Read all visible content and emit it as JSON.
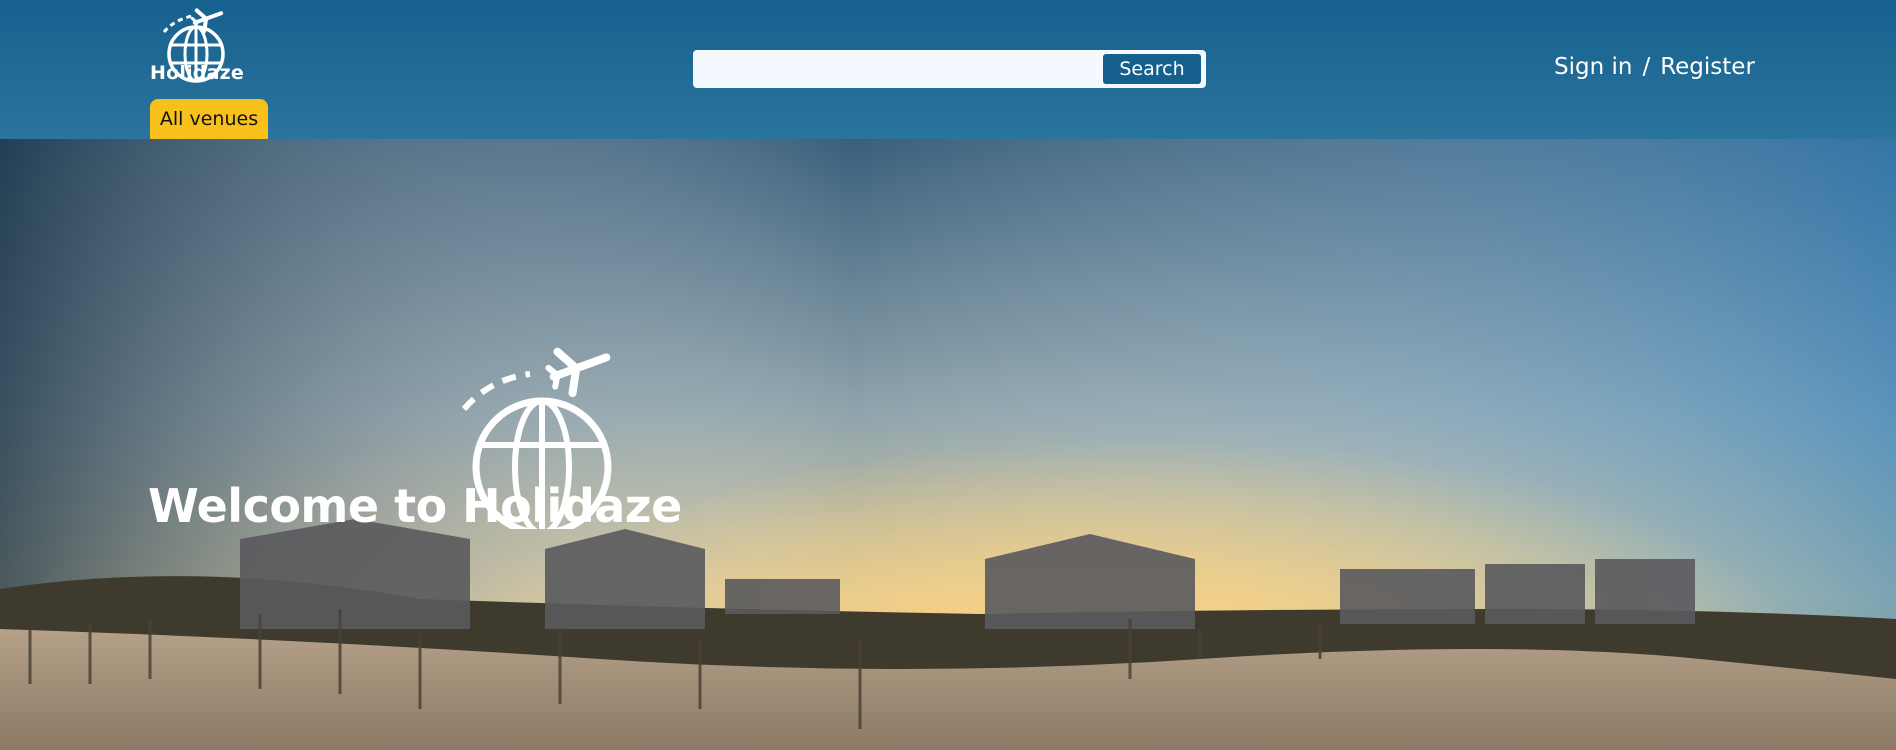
{
  "header": {
    "logo_text": "Holidaze",
    "nav_all_venues": "All venues",
    "search": {
      "placeholder": "",
      "value": "",
      "button_label": "Search"
    },
    "auth": {
      "sign_in": "Sign in",
      "separator": "/",
      "register": "Register"
    }
  },
  "hero": {
    "title": "Welcome to Holidaze"
  },
  "colors": {
    "header_top": "#16618e",
    "header_bottom": "#2a749d",
    "accent_yellow": "#f7c01a",
    "search_button": "#16608d"
  },
  "icons": [
    "globe-plane-logo-icon",
    "globe-plane-hero-icon"
  ]
}
